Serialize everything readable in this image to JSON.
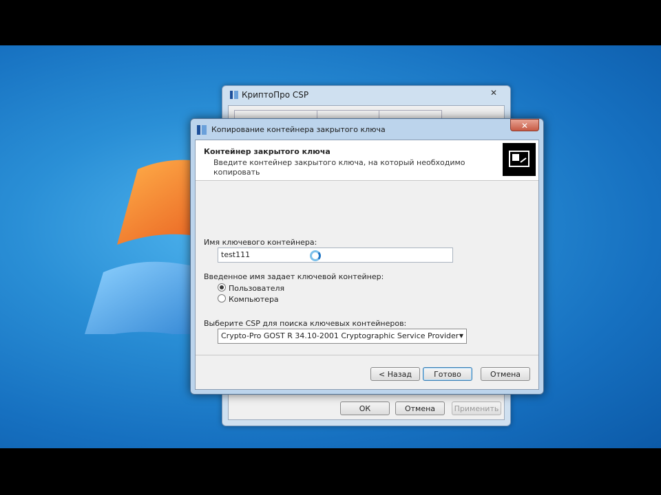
{
  "back_window": {
    "title": "КриптоПро CSP",
    "close_glyph": "✕",
    "buttons": {
      "ok": "ОК",
      "cancel": "Отмена",
      "apply": "Применить"
    }
  },
  "dialog": {
    "title": "Копирование контейнера закрытого ключа",
    "close_glyph": "✕",
    "header_title": "Контейнер закрытого ключа",
    "header_desc": "Введите контейнер закрытого ключа, на который необходимо копировать",
    "container_label": "Имя ключевого контейнера:",
    "container_value": "test111",
    "owner_label": "Введенное имя задает ключевой контейнер:",
    "radio_user": "Пользователя",
    "radio_computer": "Компьютера",
    "csp_label": "Выберите CSP для поиска ключевых контейнеров:",
    "csp_value": "Crypto-Pro GOST R 34.10-2001 Cryptographic Service Provider",
    "buttons": {
      "back": "< Назад",
      "finish": "Готово",
      "cancel": "Отмена"
    }
  },
  "colors": {
    "accent": "#1d74c4",
    "close_red": "#c75a44"
  }
}
